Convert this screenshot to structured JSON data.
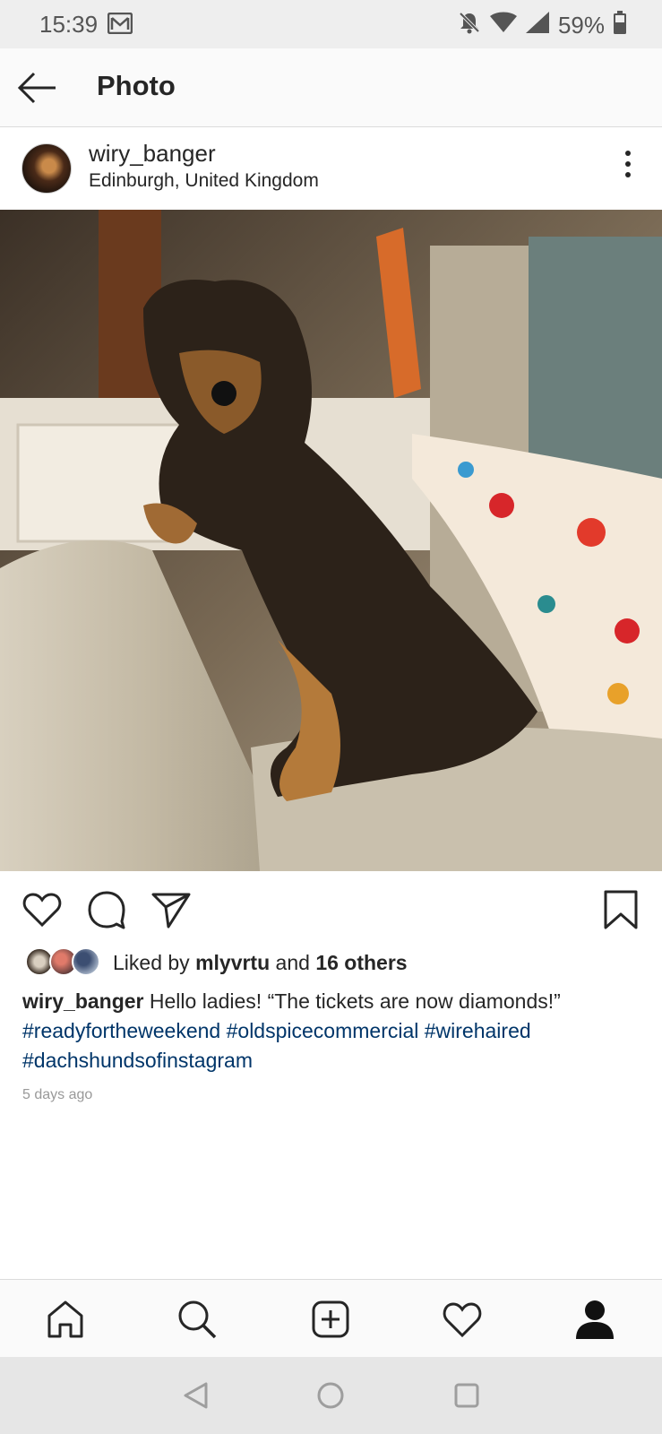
{
  "status_bar": {
    "time": "15:39",
    "battery": "59%",
    "icons": [
      "mail-icon",
      "mute-icon",
      "wifi-icon",
      "signal-icon",
      "battery-icon"
    ]
  },
  "header": {
    "title": "Photo",
    "back_icon": "arrow-left-icon"
  },
  "post": {
    "username": "wiry_banger",
    "location": "Edinburgh, United Kingdom",
    "more_icon": "more-vertical-icon",
    "image_alt": "photo"
  },
  "actions": {
    "icons": [
      "heart-icon",
      "comment-icon",
      "share-icon",
      "bookmark-icon"
    ]
  },
  "likes": {
    "prefix": "Liked by",
    "first_liker": "mlyvrtu",
    "middle": "and",
    "others": "16 others"
  },
  "caption": {
    "username": "wiry_banger",
    "text": "Hello ladies! “The tickets are now diamonds!”",
    "hashtags": [
      "#readyfortheweekend",
      "#oldspicecommercial",
      "#wirehaired",
      "#dachshundsofinstagram"
    ]
  },
  "timestamp": "5 days ago",
  "bottom_nav": {
    "items": [
      "home-icon",
      "search-icon",
      "add-post-icon",
      "activity-heart-icon",
      "profile-icon"
    ]
  },
  "system_nav": {
    "items": [
      "back-triangle-icon",
      "home-circle-icon",
      "recents-square-icon"
    ]
  },
  "colors": {
    "text": "#262626",
    "hashtag": "#003569",
    "muted": "#999999",
    "status_bg": "#eeeeee",
    "system_nav_bg": "#e6e6e6"
  }
}
